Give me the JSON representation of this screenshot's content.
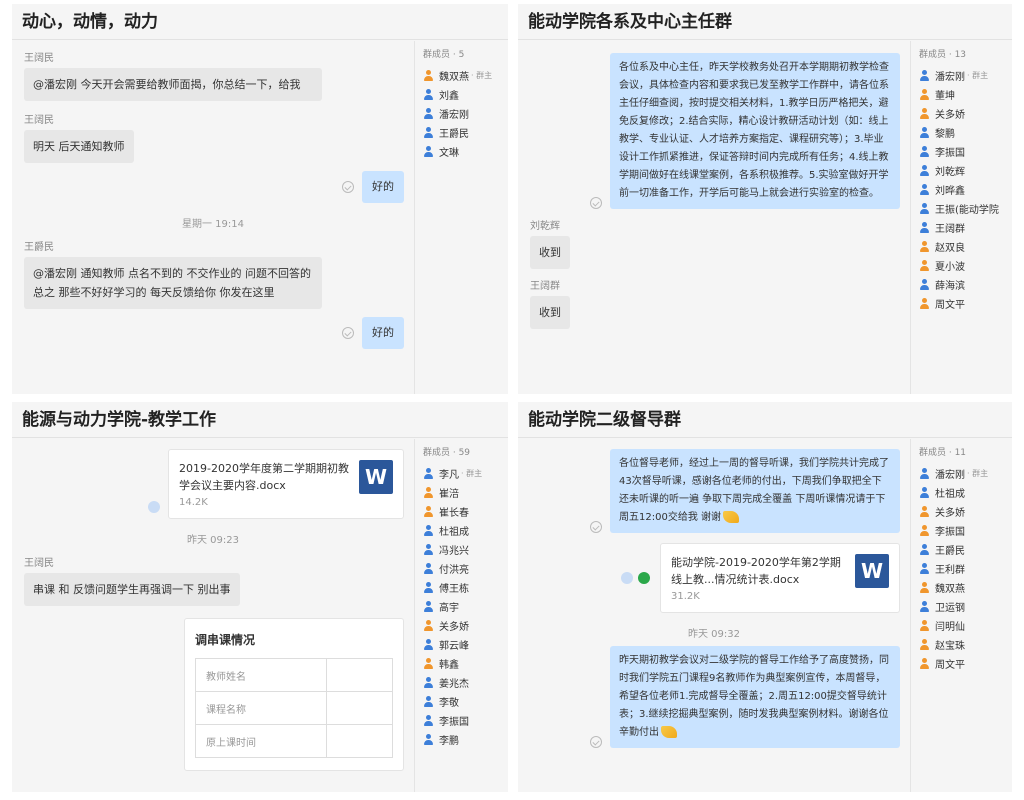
{
  "panel1": {
    "title": "动心，动情，动力",
    "members_header": "群成员 · 5",
    "members": [
      {
        "name": "魏双燕",
        "tag": "群主",
        "color": "orange"
      },
      {
        "name": "刘鑫",
        "tag": "",
        "color": "blue"
      },
      {
        "name": "潘宏刚",
        "tag": "",
        "color": "blue"
      },
      {
        "name": "王爵民",
        "tag": "",
        "color": "blue"
      },
      {
        "name": "文琳",
        "tag": "",
        "color": "blue"
      }
    ],
    "msg1_sender": "王阔民",
    "msg1_text": "@潘宏刚 今天开会需要给教师面揭，你总结一下，给我",
    "msg2_sender": "王阔民",
    "msg2_text": "明天 后天通知教师",
    "reply1": "好的",
    "time1": "星期一 19:14",
    "msg3_sender": "王爵民",
    "msg3_text": "@潘宏刚 通知教师 点名不到的 不交作业的 问题不回答的 总之 那些不好好学习的 每天反馈给你 你发在这里",
    "reply2": "好的"
  },
  "panel2": {
    "title": "能动学院各系及中心主任群",
    "members_header": "群成员 · 13",
    "members": [
      {
        "name": "潘宏刚",
        "tag": "群主",
        "color": "blue"
      },
      {
        "name": "董坤",
        "tag": "",
        "color": "orange"
      },
      {
        "name": "关多娇",
        "tag": "",
        "color": "orange"
      },
      {
        "name": "黎鹏",
        "tag": "",
        "color": "blue"
      },
      {
        "name": "李振国",
        "tag": "",
        "color": "blue"
      },
      {
        "name": "刘乾辉",
        "tag": "",
        "color": "blue"
      },
      {
        "name": "刘晔鑫",
        "tag": "",
        "color": "blue"
      },
      {
        "name": "王振(能动学院",
        "tag": "",
        "color": "blue"
      },
      {
        "name": "王阔群",
        "tag": "",
        "color": "blue"
      },
      {
        "name": "赵双良",
        "tag": "",
        "color": "orange"
      },
      {
        "name": "夏小波",
        "tag": "",
        "color": "orange"
      },
      {
        "name": "薛海滨",
        "tag": "",
        "color": "blue"
      },
      {
        "name": "周文平",
        "tag": "",
        "color": "orange"
      }
    ],
    "notice_text": "各位系及中心主任，昨天学校教务处召开本学期期初教学检查会议，具体检查内容和要求我已发至教学工作群中，请各位系主任仔细查阅，按时提交相关材料，1.教学日历严格把关，避免反复修改；2.结合实际，精心设计教研活动计划（如：线上教学、专业认证、人才培养方案指定、课程研究等）；3.毕业设计工作抓紧推进，保证答辩时间内完成所有任务；4.线上教学期间做好在线课堂案例，各系积极推荐。5.实验室做好开学前一切准备工作，开学后可能马上就会进行实验室的检查。",
    "msg1_sender": "刘乾辉",
    "msg1_text": "收到",
    "msg2_sender": "王阔群",
    "msg2_text": "收到"
  },
  "panel3": {
    "title": "能源与动力学院-教学工作",
    "members_header": "群成员 · 59",
    "members": [
      {
        "name": "李凡",
        "tag": "群主",
        "color": "blue"
      },
      {
        "name": "崔涪",
        "tag": "",
        "color": "orange"
      },
      {
        "name": "崔长春",
        "tag": "",
        "color": "orange"
      },
      {
        "name": "杜祖成",
        "tag": "",
        "color": "blue"
      },
      {
        "name": "冯兆兴",
        "tag": "",
        "color": "blue"
      },
      {
        "name": "付洪亮",
        "tag": "",
        "color": "blue"
      },
      {
        "name": "傅王栋",
        "tag": "",
        "color": "blue"
      },
      {
        "name": "高宇",
        "tag": "",
        "color": "blue"
      },
      {
        "name": "关多娇",
        "tag": "",
        "color": "orange"
      },
      {
        "name": "郭云峰",
        "tag": "",
        "color": "blue"
      },
      {
        "name": "韩鑫",
        "tag": "",
        "color": "orange"
      },
      {
        "name": "姜兆杰",
        "tag": "",
        "color": "blue"
      },
      {
        "name": "李敬",
        "tag": "",
        "color": "blue"
      },
      {
        "name": "李振国",
        "tag": "",
        "color": "blue"
      },
      {
        "name": "李鹏",
        "tag": "",
        "color": "blue"
      }
    ],
    "file_name": "2019-2020学年度第二学期期初教学会议主要内容.docx",
    "file_size": "14.2K",
    "word_letter": "W",
    "time1": "昨天 09:23",
    "msg1_sender": "王阔民",
    "msg1_text": "串课 和 反馈问题学生再强调一下 别出事",
    "form_title": "调串课情况",
    "form_rows": [
      "教师姓名",
      "课程名称",
      "原上课时间"
    ]
  },
  "panel4": {
    "title": "能动学院二级督导群",
    "members_header": "群成员 · 11",
    "members": [
      {
        "name": "潘宏刚",
        "tag": "群主",
        "color": "blue"
      },
      {
        "name": "杜祖成",
        "tag": "",
        "color": "blue"
      },
      {
        "name": "关多娇",
        "tag": "",
        "color": "orange"
      },
      {
        "name": "李振国",
        "tag": "",
        "color": "orange"
      },
      {
        "name": "王爵民",
        "tag": "",
        "color": "blue"
      },
      {
        "name": "王利群",
        "tag": "",
        "color": "blue"
      },
      {
        "name": "魏双燕",
        "tag": "",
        "color": "orange"
      },
      {
        "name": "卫运钢",
        "tag": "",
        "color": "blue"
      },
      {
        "name": "闫明仙",
        "tag": "",
        "color": "orange"
      },
      {
        "name": "赵宝珠",
        "tag": "",
        "color": "orange"
      },
      {
        "name": "周文平",
        "tag": "",
        "color": "orange"
      }
    ],
    "msg1_text": "各位督导老师，经过上一周的督导听课，我们学院共计完成了43次督导听课，感谢各位老师的付出，下周我们争取把全下还未听课的听一遍 争取下周完成全覆盖 下周听课情况请于下周五12:00交给我 谢谢",
    "file_name": "能动学院-2019-2020学年第2学期线上教...情况统计表.docx",
    "file_size": "31.2K",
    "word_letter": "W",
    "time1": "昨天 09:32",
    "msg2_text": "昨天期初教学会议对二级学院的督导工作给予了高度赞扬，同时我们学院五门课程9名教师作为典型案例宣传，本周督导，希望各位老师1.完成督导全覆盖；2.周五12:00提交督导统计表；3.继续挖掘典型案例，随时发我典型案例材料。谢谢各位辛勤付出"
  },
  "colors": {
    "self_bubble": "#c9e3ff",
    "other_bubble": "#e7e7e7",
    "word_blue": "#2b579a",
    "orange_member": "#f0962d",
    "blue_member": "#3d7fd9"
  }
}
